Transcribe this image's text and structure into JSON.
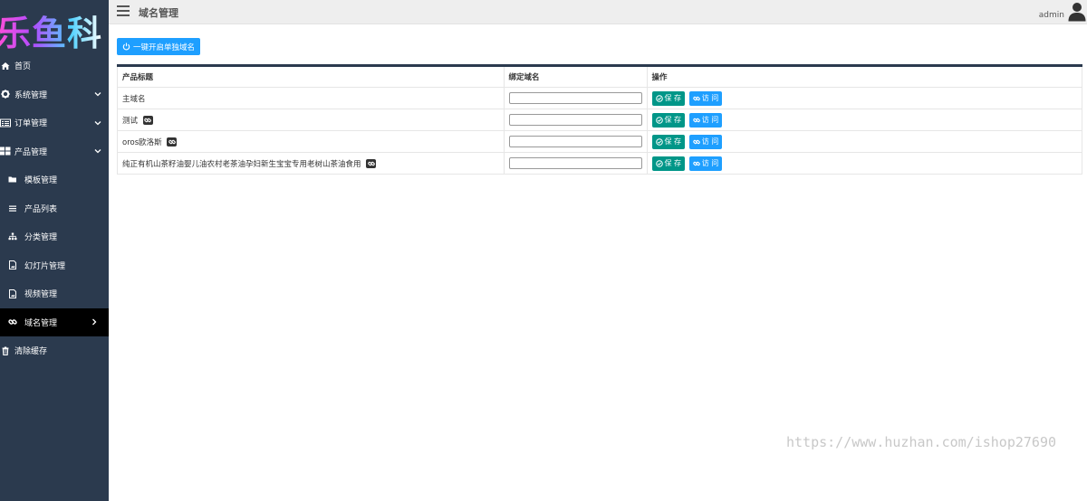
{
  "logo": {
    "text": "乐鱼科"
  },
  "sidebar": {
    "items": [
      {
        "label": "首页",
        "icon": "home-icon"
      },
      {
        "label": "系统管理",
        "icon": "gear-icon",
        "chevron": "down"
      },
      {
        "label": "订单管理",
        "icon": "list-icon",
        "chevron": "down"
      },
      {
        "label": "产品管理",
        "icon": "grid-icon",
        "chevron": "down"
      },
      {
        "label": "模板管理",
        "icon": "folder-icon",
        "sub": true
      },
      {
        "label": "产品列表",
        "icon": "bars-icon",
        "sub": true
      },
      {
        "label": "分类管理",
        "icon": "sitemap-icon",
        "sub": true
      },
      {
        "label": "幻灯片管理",
        "icon": "image-icon",
        "sub": true
      },
      {
        "label": "视频管理",
        "icon": "image-icon",
        "sub": true
      },
      {
        "label": "域名管理",
        "icon": "link-icon",
        "sub": true,
        "active": true,
        "chevron": "right"
      },
      {
        "label": "清除缓存",
        "icon": "trash-icon"
      }
    ]
  },
  "header": {
    "title": "域名管理",
    "user": "admin"
  },
  "main": {
    "enable_button": "一键开启单独域名",
    "table": {
      "headers": [
        "产品标题",
        "绑定域名",
        "操作"
      ],
      "rows": [
        {
          "title": "主域名",
          "has_link": false,
          "domain": ""
        },
        {
          "title": "测试",
          "has_link": true,
          "domain": ""
        },
        {
          "title": "oros欧洛斯",
          "has_link": true,
          "domain": ""
        },
        {
          "title": "纯正有机山茶籽油婴儿油农村老茶油孕妇新生宝宝专用老树山茶油食用",
          "has_link": true,
          "domain": ""
        }
      ],
      "save_label": "保 存",
      "visit_label": "访 问"
    }
  },
  "watermark": "https://www.huzhan.com/ishop27690",
  "colors": {
    "sidebar_bg": "#2b3a4e",
    "active_bg": "#000000",
    "primary": "#1e9fff",
    "save": "#009688"
  }
}
